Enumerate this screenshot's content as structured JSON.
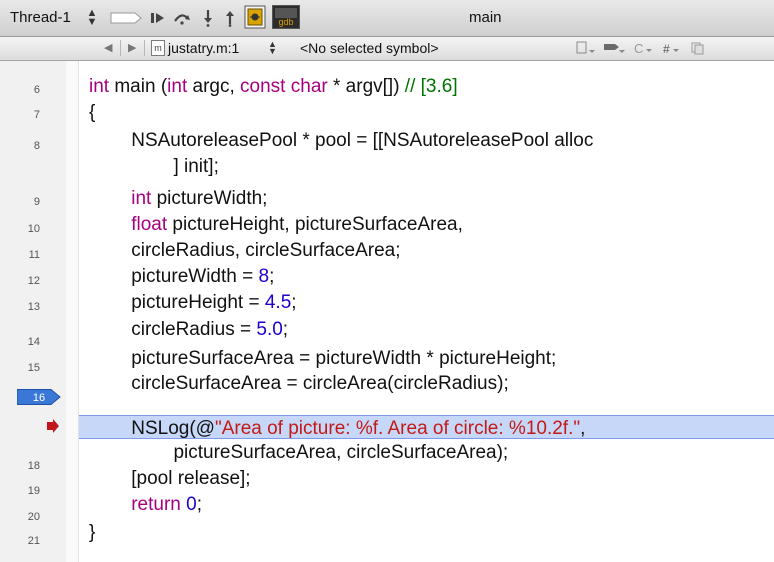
{
  "toolbar": {
    "thread_label": "Thread-1",
    "function_label": "main",
    "buttons": [
      "breakpoints-toggle-icon",
      "continue-icon",
      "step-over-icon",
      "step-into-icon",
      "step-out-icon",
      "debugger-window-icon",
      "gdb-console-icon"
    ],
    "gdb_text": "gdb"
  },
  "navbar": {
    "file_label": "justatry.m:1",
    "file_icon_letter": "m",
    "symbol_label": "<No selected symbol>"
  },
  "editor": {
    "line_numbers": [
      "6",
      "7",
      "8",
      "",
      "9",
      "10",
      "11",
      "12",
      "13",
      "14",
      "15",
      "16",
      "",
      "18",
      "19",
      "20",
      "21"
    ],
    "breakpoint_line": "16",
    "lines": [
      [
        {
          "t": "int",
          "c": "kw"
        },
        {
          "t": " main ("
        },
        {
          "t": "int",
          "c": "kw"
        },
        {
          "t": " argc, "
        },
        {
          "t": "const",
          "c": "kw"
        },
        {
          "t": " "
        },
        {
          "t": "char",
          "c": "kw"
        },
        {
          "t": " * argv[]) "
        },
        {
          "t": "// [3.6]",
          "c": "cm"
        }
      ],
      [
        {
          "t": "{"
        }
      ],
      [
        {
          "t": "        NSAutoreleasePool * pool = [[NSAutoreleasePool alloc"
        }
      ],
      [
        {
          "t": "                ] init];"
        }
      ],
      [
        {
          "t": "        "
        },
        {
          "t": "int",
          "c": "kw"
        },
        {
          "t": " pictureWidth;"
        }
      ],
      [
        {
          "t": "        "
        },
        {
          "t": "float",
          "c": "kw"
        },
        {
          "t": " pictureHeight, pictureSurfaceArea,"
        }
      ],
      [
        {
          "t": "        circleRadius, circleSurfaceArea;"
        }
      ],
      [
        {
          "t": "        pictureWidth = "
        },
        {
          "t": "8",
          "c": "num"
        },
        {
          "t": ";"
        }
      ],
      [
        {
          "t": "        pictureHeight = "
        },
        {
          "t": "4.5",
          "c": "num"
        },
        {
          "t": ";"
        }
      ],
      [
        {
          "t": "        circleRadius = "
        },
        {
          "t": "5.0",
          "c": "num"
        },
        {
          "t": ";"
        }
      ],
      [
        {
          "t": "        pictureSurfaceArea = pictureWidth * pictureHeight;"
        }
      ],
      [
        {
          "t": "        circleSurfaceArea = circleArea(circleRadius);"
        }
      ],
      [
        {
          "t": "        NSLog(@"
        },
        {
          "t": "\"Area of picture: %f. Area of circle: %10.2f.\"",
          "c": "str"
        },
        {
          "t": ","
        }
      ],
      [
        {
          "t": "                pictureSurfaceArea, circleSurfaceArea);"
        }
      ],
      [
        {
          "t": "        [pool release];"
        }
      ],
      [
        {
          "t": "        "
        },
        {
          "t": "return",
          "c": "kw"
        },
        {
          "t": " "
        },
        {
          "t": "0",
          "c": "num"
        },
        {
          "t": ";"
        }
      ],
      [
        {
          "t": "}"
        }
      ]
    ]
  },
  "colors": {
    "keyword": "#a6007f",
    "number": "#1c00cf",
    "comment": "#007400",
    "string": "#c41a16",
    "current_line": "#c6d7f7",
    "breakpoint": "#3a78d8",
    "program_counter": "#c0161c"
  }
}
